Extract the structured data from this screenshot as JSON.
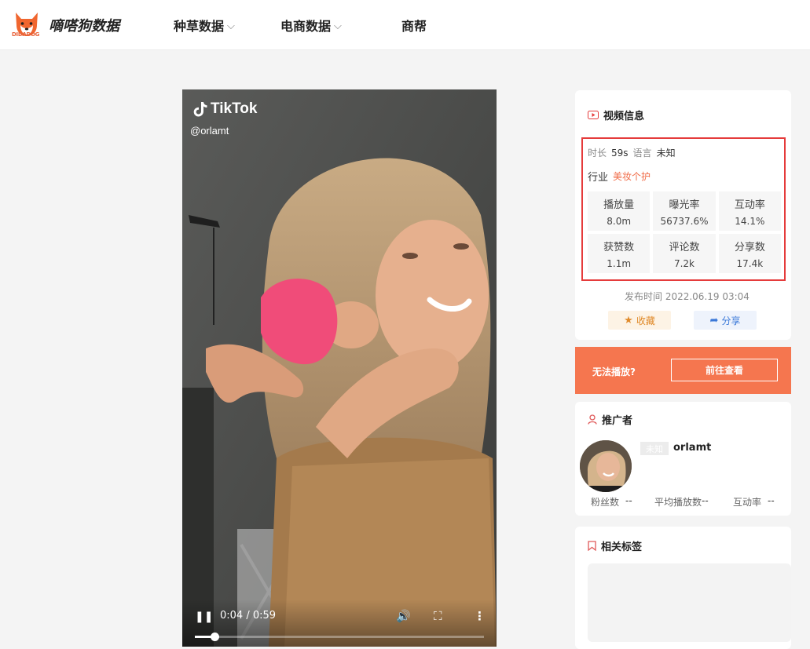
{
  "header": {
    "logo_sub": "DIDADOG",
    "brand": "嘀嗒狗数据",
    "nav": [
      {
        "label": "种草数据",
        "chevron": "⌵"
      },
      {
        "label": "电商数据",
        "chevron": "⌵"
      },
      {
        "label": "商帮"
      }
    ]
  },
  "video": {
    "platform": "TikTok",
    "handle": "@orlamt",
    "current_time": "0:04 / 0:59",
    "progress_fraction": 0.068,
    "controls": {
      "play": "❚❚",
      "volume": "🔊",
      "fullscreen": "⛶",
      "more": "⋮"
    }
  },
  "video_info": {
    "title": "视频信息",
    "duration_label": "时长",
    "duration": "59s",
    "language_label": "语言",
    "language": "未知",
    "industry_label": "行业",
    "industry": "美妆个护",
    "stats": [
      {
        "label": "播放量",
        "value": "8.0m"
      },
      {
        "label": "曝光率",
        "value": "56737.6%"
      },
      {
        "label": "互动率",
        "value": "14.1%"
      },
      {
        "label": "获赞数",
        "value": "1.1m"
      },
      {
        "label": "评论数",
        "value": "7.2k"
      },
      {
        "label": "分享数",
        "value": "17.4k"
      }
    ],
    "publish_time": "发布时间 2022.06.19 03:04",
    "favorite_label": "收藏",
    "share_label": "分享"
  },
  "cta": {
    "text": "无法播放?",
    "button": "前往查看"
  },
  "promoter": {
    "title": "推广者",
    "badge": "未知",
    "name": "orlamt",
    "fans_label": "粉丝数",
    "fans": "--",
    "avg_play_label": "平均播放数",
    "avg_play": "--",
    "engagement_label": "互动率",
    "engagement": "--"
  },
  "tags": {
    "title": "相关标签"
  },
  "colors": {
    "accent": "#f5764f",
    "highlight_border": "#e53b3b",
    "industry_tag": "#f06b47"
  }
}
